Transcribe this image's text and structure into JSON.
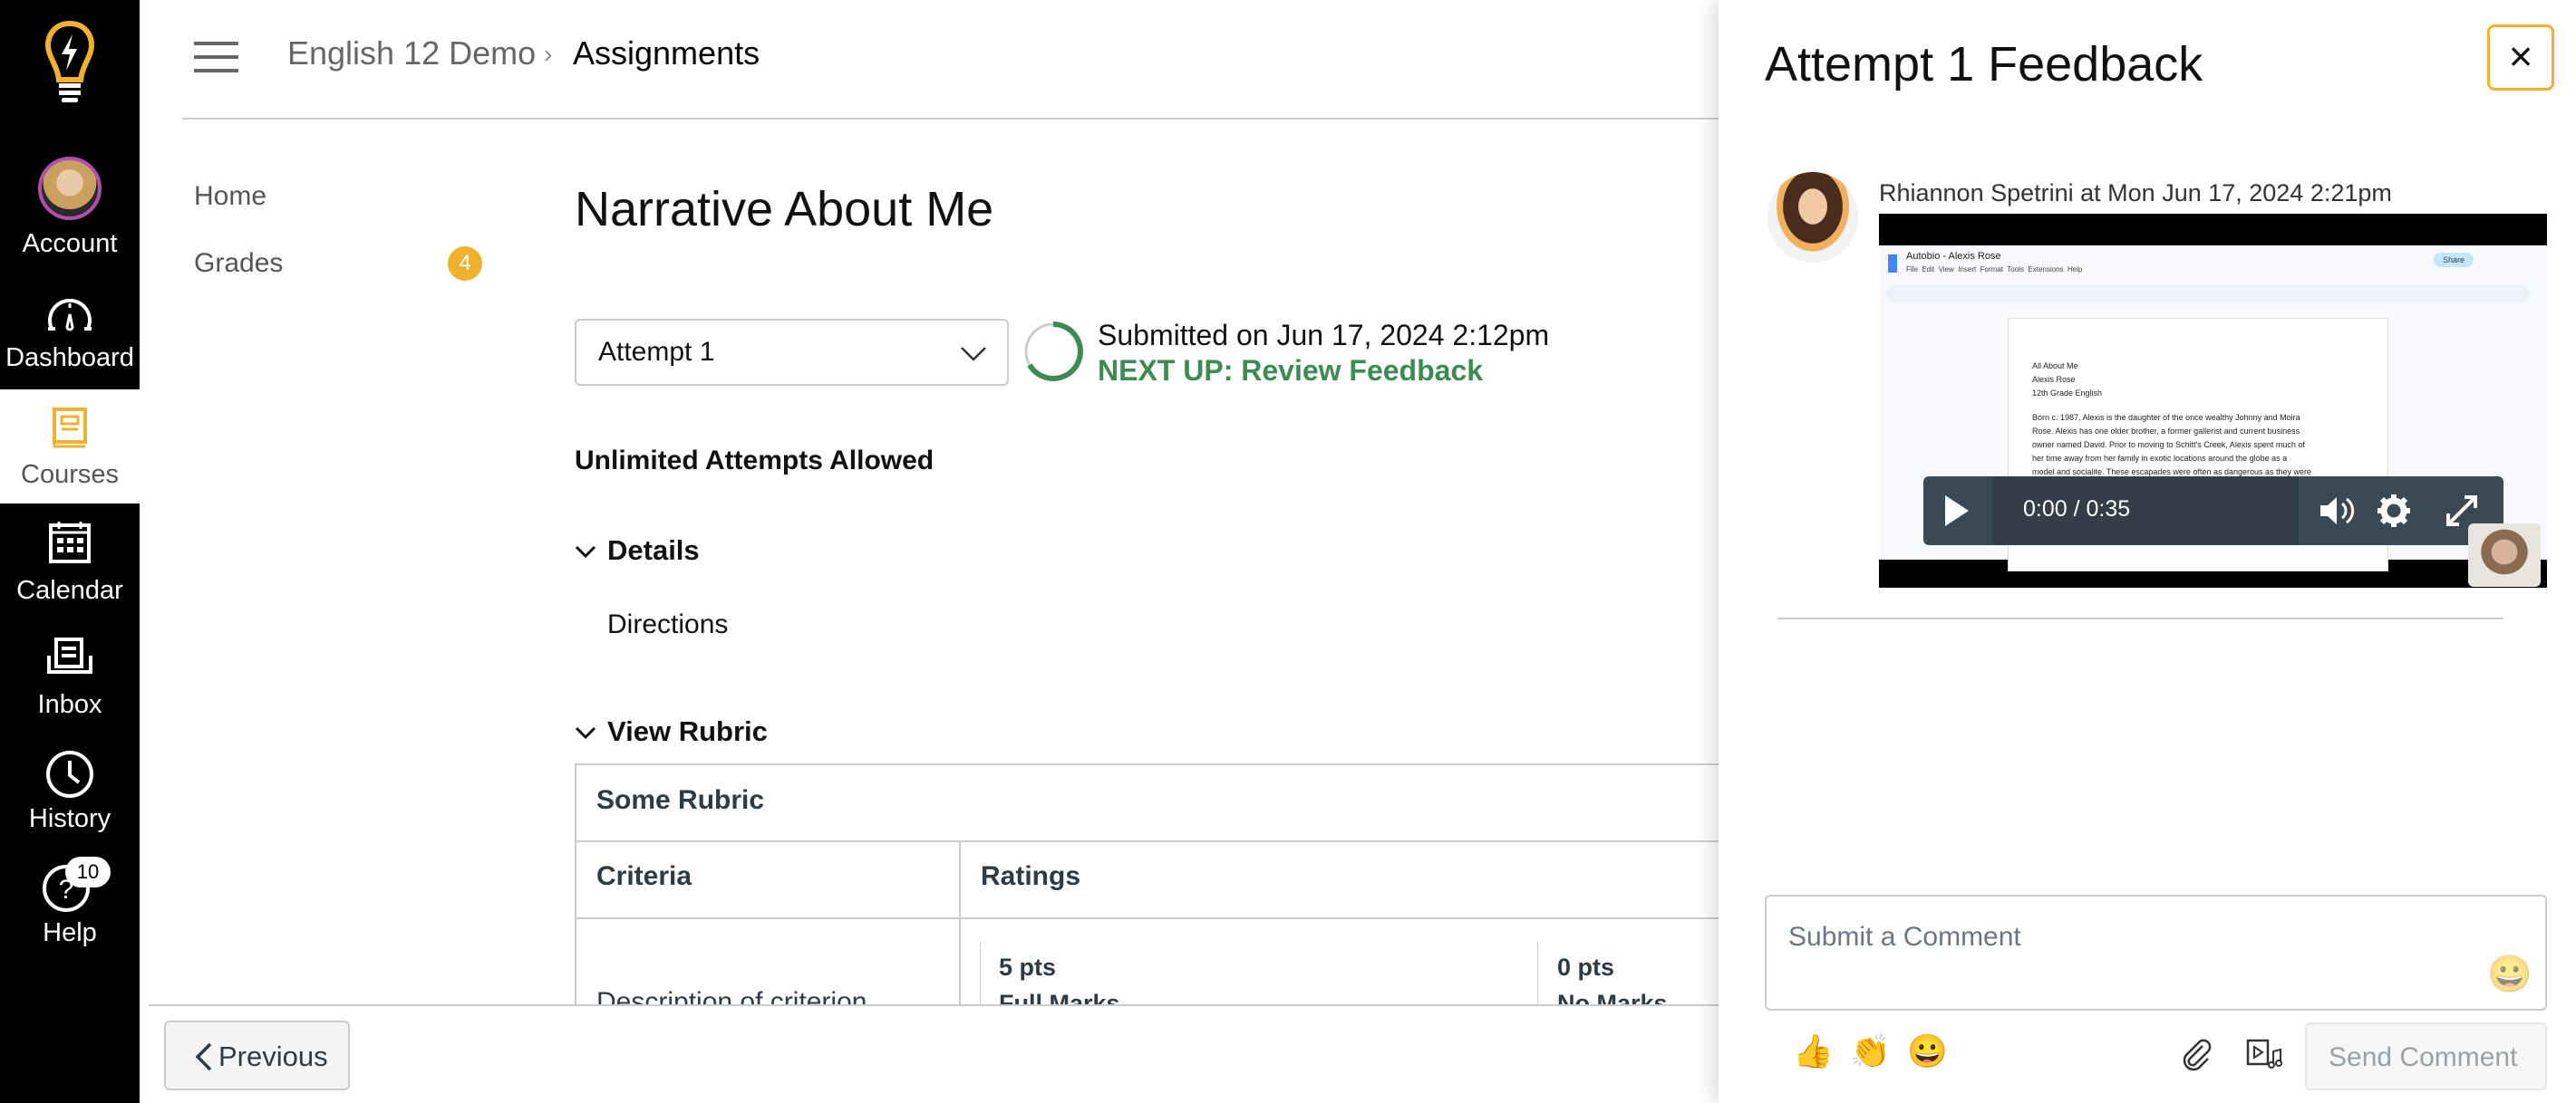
{
  "global_nav": {
    "items": [
      {
        "label": "Account",
        "icon": "avatar"
      },
      {
        "label": "Dashboard",
        "icon": "dashboard-icon"
      },
      {
        "label": "Courses",
        "icon": "courses-icon"
      },
      {
        "label": "Calendar",
        "icon": "calendar-icon"
      },
      {
        "label": "Inbox",
        "icon": "inbox-icon"
      },
      {
        "label": "History",
        "icon": "history-icon"
      },
      {
        "label": "Help",
        "icon": "help-icon",
        "badge": "10"
      }
    ]
  },
  "breadcrumb": {
    "course": "English 12 Demo",
    "separator": "›",
    "page": "Assignments"
  },
  "course_nav": {
    "items": [
      {
        "label": "Home"
      },
      {
        "label": "Grades",
        "badge": "4"
      }
    ]
  },
  "assignment": {
    "title": "Narrative About Me",
    "attempt_select": "Attempt 1",
    "submitted": "Submitted on Jun 17, 2024 2:12pm",
    "next_up": "NEXT UP: Review Feedback",
    "attempts_allowed": "Unlimited Attempts Allowed",
    "details_label": "Details",
    "directions_label": "Directions",
    "view_rubric_label": "View Rubric",
    "rubric": {
      "name": "Some Rubric",
      "headers": [
        "Criteria",
        "Ratings"
      ],
      "rows": [
        {
          "criterion": "Description of criterion",
          "ratings": [
            {
              "pts": "5 pts",
              "label": "Full Marks"
            },
            {
              "pts": "0 pts",
              "label": "No Marks"
            }
          ]
        }
      ]
    }
  },
  "footer": {
    "previous_label": "Previous"
  },
  "feedback_panel": {
    "title": "Attempt 1 Feedback",
    "close_label": "×",
    "comment": {
      "author_line": "Rhiannon Spetrini at Mon Jun 17, 2024 2:21pm",
      "video": {
        "time": "0:00 / 0:35",
        "doc_title": "Autobio - Alexis Rose",
        "doc_menu": "File  Edit  View  Insert  Format  Tools  Extensions  Help",
        "share": "Share",
        "doc_lines": [
          "All About Me",
          "Alexis Rose",
          "12th Grade English",
          "",
          "Born c. 1987, Alexis is the daughter of the once wealthy Johnny and Moira",
          "Rose. Alexis has one older brother, a former gallerist and current business",
          "owner named David. Prior to moving to Schitt's Creek, Alexis spent much of",
          "her time away from her family in exotic locations around the globe as a",
          "model and socialite. These escapades were often as dangerous as they were"
        ]
      }
    },
    "comment_placeholder": "Submit a Comment",
    "quick_emojis": [
      "👍",
      "👏",
      "😀"
    ],
    "emoji_picker": "😀",
    "send_label": "Send Comment"
  },
  "colors": {
    "brand_yellow": "#f0b030",
    "success_green": "#3d8a52",
    "nav_bg": "#000000",
    "text": "#2d3b45"
  }
}
